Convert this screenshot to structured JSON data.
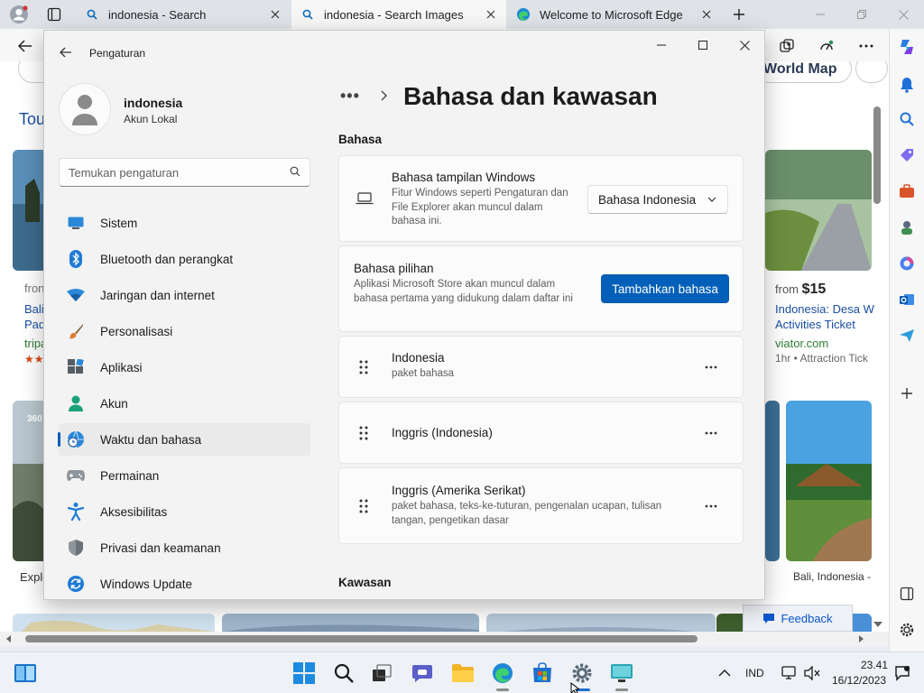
{
  "browser": {
    "tabs": [
      {
        "title": "indonesia - Search",
        "active": false
      },
      {
        "title": "indonesia - Search Images",
        "active": true
      },
      {
        "title": "Welcome to Microsoft Edge",
        "active": false
      }
    ]
  },
  "page_behind": {
    "world_map_label": "World Map",
    "tours_label": "Tou",
    "from_label": "fron",
    "bali_line1": "Bali",
    "bali_line2": "Pad",
    "tripa_label": "tripa",
    "pano_badge": "360",
    "explore_label": "Explo",
    "right_from": "from",
    "right_price": "$15",
    "right_title_line1": "Indonesia: Desa W",
    "right_title_line2": "Activities Ticket",
    "right_site": "viator.com",
    "right_meta": "1hr • Attraction Tick",
    "right_caption": "Bali, Indonesia -",
    "feedback_label": "Feedback"
  },
  "settings": {
    "window_title": "Pengaturan",
    "account": {
      "name": "indonesia",
      "type": "Akun Lokal"
    },
    "search_placeholder": "Temukan pengaturan",
    "nav": [
      {
        "label": "Sistem",
        "icon": "system-icon"
      },
      {
        "label": "Bluetooth dan perangkat",
        "icon": "bluetooth-icon"
      },
      {
        "label": "Jaringan dan internet",
        "icon": "wifi-icon"
      },
      {
        "label": "Personalisasi",
        "icon": "brush-icon"
      },
      {
        "label": "Aplikasi",
        "icon": "apps-icon"
      },
      {
        "label": "Akun",
        "icon": "account-icon"
      },
      {
        "label": "Waktu dan bahasa",
        "icon": "globe-clock-icon",
        "selected": true
      },
      {
        "label": "Permainan",
        "icon": "gamepad-icon"
      },
      {
        "label": "Aksesibilitas",
        "icon": "accessibility-icon"
      },
      {
        "label": "Privasi dan keamanan",
        "icon": "shield-icon"
      },
      {
        "label": "Windows Update",
        "icon": "update-icon"
      }
    ],
    "breadcrumb_dots": "•••",
    "page_title": "Bahasa dan kawasan",
    "section_language": "Bahasa",
    "display_language": {
      "title": "Bahasa tampilan Windows",
      "description": "Fitur Windows seperti Pengaturan dan File Explorer akan muncul dalam bahasa ini.",
      "selected": "Bahasa Indonesia"
    },
    "preferred": {
      "title": "Bahasa pilihan",
      "description": "Aplikasi Microsoft Store akan muncul dalam bahasa pertama yang didukung dalam daftar ini",
      "button": "Tambahkan bahasa"
    },
    "languages": [
      {
        "name": "Indonesia",
        "detail": "paket bahasa"
      },
      {
        "name": "Inggris (Indonesia)",
        "detail": ""
      },
      {
        "name": "Inggris (Amerika Serikat)",
        "detail": "paket bahasa, teks-ke-tuturan, pengenalan ucapan, tulisan tangan, pengetikan dasar"
      }
    ],
    "section_region": "Kawasan"
  },
  "taskbar": {
    "language": "IND",
    "time": "23.41",
    "date": "16/12/2023"
  },
  "colors": {
    "accent": "#005fb8",
    "taskbar": "#eef1f6",
    "settings_bg": "#f3f3f3"
  }
}
